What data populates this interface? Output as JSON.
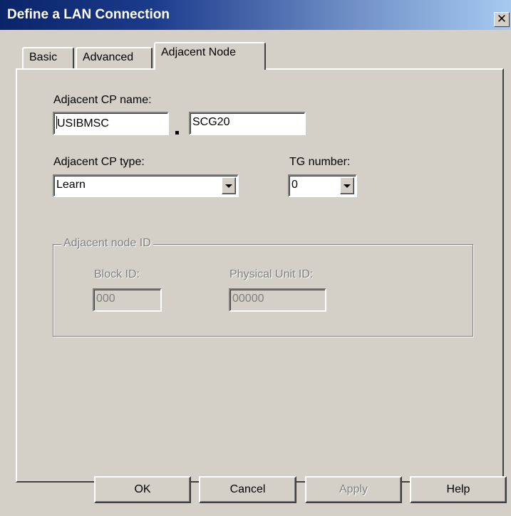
{
  "window": {
    "title": "Define a LAN Connection",
    "close_glyph": "✕"
  },
  "tabs": [
    {
      "label": "Basic",
      "active": false
    },
    {
      "label": "Advanced",
      "active": false
    },
    {
      "label": "Adjacent Node",
      "active": true
    }
  ],
  "adjacent_cp": {
    "name_label": "Adjacent CP name:",
    "network_name": "USIBMSC",
    "cp_name": "SCG20",
    "type_label": "Adjacent CP type:",
    "type_value": "Learn",
    "tg_label": "TG number:",
    "tg_value": "0"
  },
  "adjacent_node_id": {
    "legend": "Adjacent node ID",
    "block_id_label": "Block ID:",
    "block_id_value": "000",
    "pu_id_label": "Physical Unit ID:",
    "pu_id_value": "00000"
  },
  "buttons": {
    "ok": "OK",
    "cancel": "Cancel",
    "apply": "Apply",
    "help": "Help"
  }
}
